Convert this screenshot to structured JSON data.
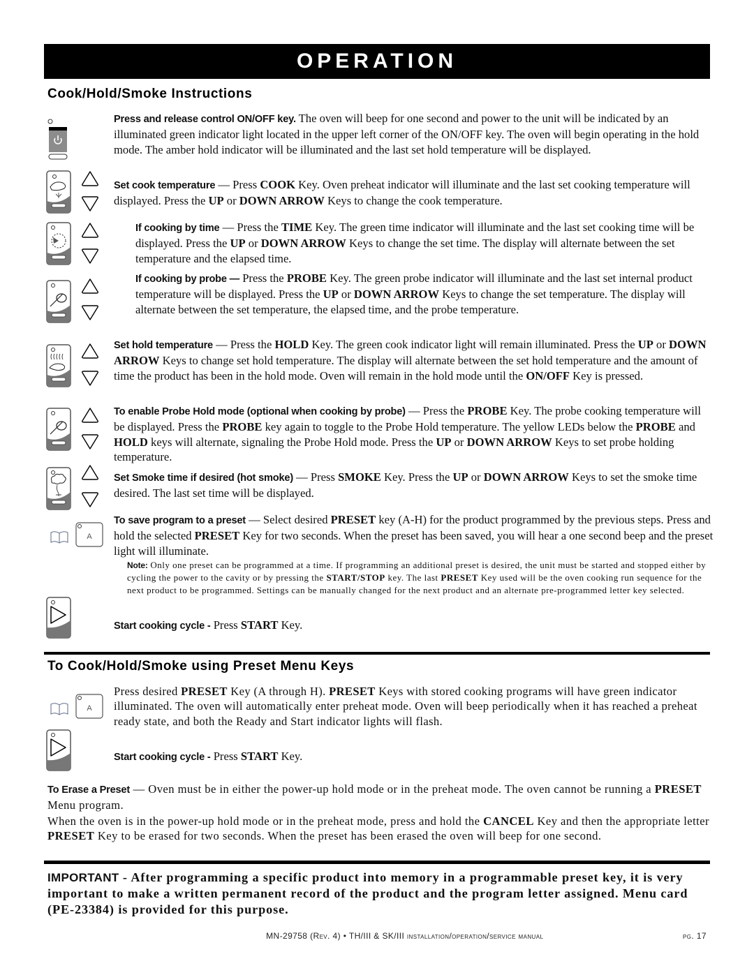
{
  "banner": {
    "title": "OPERATION"
  },
  "section1": {
    "heading": "Cook/Hold/Smoke Instructions",
    "items": [
      {
        "icon": "power-key-icon",
        "lead": "Press and release control ON/OFF key.",
        "text": " The oven will beep for one second and power to the unit will be indicated by an illuminated green indicator light located in the upper left corner of the ON/OFF key.  The oven will begin operating in the hold mode.  The amber hold indicator will be illuminated and the last set hold temperature will be displayed."
      },
      {
        "icon": "cook-key-icon",
        "lead": "Set cook temperature",
        "text_parts": [
          " — Press ",
          "COOK",
          " Key.  Oven preheat indicator will illuminate and the last set cooking temperature will displayed.  Press the ",
          "UP",
          " or ",
          "DOWN ARROW",
          " Keys to change the cook temperature."
        ]
      },
      {
        "icon": "time-key-icon",
        "lead": "If cooking by time",
        "text_parts": [
          " — Press the ",
          "TIME",
          " Key.  The green time indicator will illuminate and the last set cooking time will be displayed.  Press the ",
          "UP",
          " or ",
          "DOWN ARROW",
          " Keys to change the set time.  The display will alternate between the set temperature and the elapsed time."
        ]
      },
      {
        "icon": "probe-key-icon",
        "lead": "If cooking by probe —",
        "text_parts": [
          " Press the ",
          "PROBE",
          " Key.  The green probe indicator will illuminate and the last set internal product temperature will be displayed.  Press the ",
          "UP",
          " or ",
          "DOWN ARROW",
          " Keys to change the set temperature.  The display will alternate between the set temperature, the elapsed time, and the probe temperature."
        ]
      },
      {
        "icon": "hold-key-icon",
        "lead": "Set hold temperature",
        "text_parts": [
          " — Press the ",
          "HOLD",
          " Key. The green cook indicator light will remain illuminated. Press the ",
          "UP",
          " or ",
          "DOWN ARROW",
          " Keys to change set hold temperature.  The display will alternate between the set hold temperature and the amount of time the product has been in the hold mode.  Oven will remain in the hold mode until the ",
          "ON/OFF",
          " Key is pressed."
        ]
      },
      {
        "icon": "probe-key-icon",
        "lead": "To enable Probe Hold mode (optional when cooking by probe)",
        "text_parts": [
          " — Press the ",
          "PROBE",
          " Key. The probe cooking temperature will be displayed. Press the ",
          "PROBE",
          " key again to toggle to the Probe Hold temperature. The yellow LEDs below the ",
          "PROBE",
          " and ",
          "HOLD",
          " keys will alternate, signaling the Probe Hold mode.  Press the ",
          "UP",
          " or ",
          "DOWN ARROW",
          " Keys to set probe holding temperature."
        ]
      },
      {
        "icon": "smoke-key-icon",
        "lead": "Set Smoke time if desired (hot smoke)",
        "text_parts": [
          " — Press ",
          "SMOKE",
          " Key.  Press the ",
          "UP",
          " or ",
          "DOWN ARROW",
          " Keys to set the smoke time desired.  The last set time will be displayed."
        ]
      },
      {
        "icon": "preset-key-icon",
        "lead": "To save program to a preset",
        "text_parts": [
          " —  Select desired ",
          "PRESET",
          " key (A-H) for the product programmed by the previous steps.  Press and hold the selected ",
          "PRESET",
          " Key for two seconds.  When the preset has been saved, you will hear a one second beep and the preset light will illuminate."
        ]
      }
    ],
    "note": {
      "lead": "Note:",
      "text_parts": [
        " Only one preset can be programmed at a time. If programming an additional preset is desired, the unit must be started and stopped either by cycling the power to the cavity or by pressing the ",
        "START/STOP",
        " key. The last ",
        "PRESET",
        " Key used will be the oven cooking run sequence for the next product to be programmed.  Settings can be manually changed for the next product and an alternate pre-programmed letter key selected."
      ]
    },
    "start": {
      "lead": "Start cooking cycle -",
      "text_parts": [
        " Press ",
        "START",
        " Key."
      ]
    },
    "preset_key_letter": "A"
  },
  "section2": {
    "heading": "To Cook/Hold/Smoke using Preset Menu Keys",
    "preset": {
      "text_parts": [
        "Press desired ",
        "PRESET",
        " Key (A through H).  ",
        "PRESET",
        " Keys with stored cooking programs will have green indicator illuminated.  The oven will automatically enter preheat mode. Oven will beep periodically when it has reached a preheat ready state, and both the Ready and Start indicator lights will flash."
      ]
    },
    "start": {
      "lead": "Start cooking cycle -",
      "text_parts": [
        " Press ",
        "START",
        " Key."
      ]
    },
    "erase": {
      "lead": "To Erase a Preset",
      "text_parts": [
        " — Oven must be in either the power-up hold mode or in the preheat mode.  The oven cannot be running a ",
        "PRESET",
        " Menu program."
      ]
    },
    "erase_detail": {
      "text_parts": [
        "When the oven is in the power-up hold mode or in the preheat mode, press and hold the ",
        "CANCEL",
        " Key and then the appropriate letter ",
        "PRESET",
        " Key to be erased for two seconds.  When the preset has been erased the oven will beep for one second."
      ]
    },
    "preset_key_letter": "A"
  },
  "important": {
    "lead": "IMPORTANT",
    "text": " - After programming a specific product into memory in a programmable preset key, it is very important to make a written permanent record of the product and the program letter assigned.  Menu card (PE-23384) is provided for this purpose."
  },
  "footer": {
    "doc_id": "MN-29758 (",
    "rev": "Rev. 4",
    "models": ") • TH/III & SK/III ",
    "manual": "installation/operation/service manual",
    "page_label": "pg.",
    "page_number": "17"
  }
}
